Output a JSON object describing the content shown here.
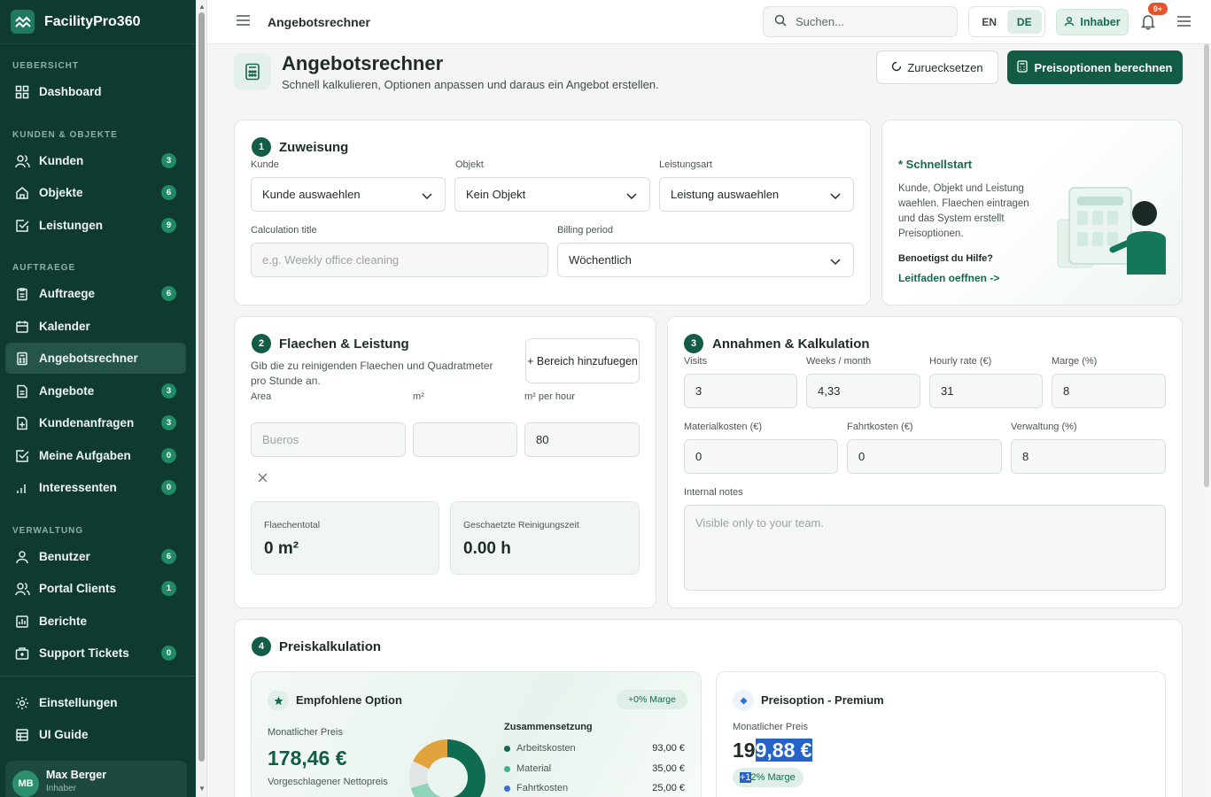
{
  "brand": {
    "name": "FacilityPro360"
  },
  "sidebar": {
    "sections": [
      "UEBERSICHT",
      "KUNDEN & OBJEKTE",
      "AUFTRAEGE",
      "VERWALTUNG"
    ],
    "items": [
      {
        "label": "Dashboard",
        "icon": "grid-icon"
      },
      {
        "label": "Kunden",
        "badge": "3",
        "icon": "users-icon"
      },
      {
        "label": "Objekte",
        "badge": "6",
        "icon": "home-icon"
      },
      {
        "label": "Leistungen",
        "badge": "9",
        "icon": "check-square-icon"
      },
      {
        "label": "Auftraege",
        "badge": "6",
        "icon": "clipboard-icon"
      },
      {
        "label": "Kalender",
        "icon": "calendar-icon"
      },
      {
        "label": "Angebotsrechner",
        "icon": "calculator-icon",
        "active": true
      },
      {
        "label": "Angebote",
        "badge": "3",
        "icon": "file-icon"
      },
      {
        "label": "Kundenanfragen",
        "badge": "3",
        "icon": "file-plus-icon"
      },
      {
        "label": "Meine Aufgaben",
        "badge": "0",
        "icon": "check-square-icon"
      },
      {
        "label": "Interessenten",
        "badge": "0",
        "icon": "bar-chart-icon"
      },
      {
        "label": "Benutzer",
        "badge": "6",
        "icon": "user-icon"
      },
      {
        "label": "Portal Clients",
        "badge": "1",
        "icon": "users-icon"
      },
      {
        "label": "Berichte",
        "icon": "report-icon"
      },
      {
        "label": "Support Tickets",
        "badge": "0",
        "icon": "ticket-icon"
      },
      {
        "label": "Einstellungen",
        "icon": "gear-icon"
      },
      {
        "label": "UI Guide",
        "icon": "table-icon"
      }
    ],
    "user": {
      "initials": "MB",
      "name": "Max Berger",
      "role": "Inhaber"
    }
  },
  "topbar": {
    "title": "Angebotsrechner",
    "search_placeholder": "Suchen...",
    "lang_en": "EN",
    "lang_de": "DE",
    "role": "Inhaber",
    "notifications": "9+"
  },
  "header": {
    "title": "Angebotsrechner",
    "subtitle": "Schnell kalkulieren, Optionen anpassen und daraus ein Angebot erstellen.",
    "reset_label": "Zuruecksetzen",
    "calc_label": "Preisoptionen berechnen"
  },
  "assignment": {
    "step": "1",
    "title": "Zuweisung",
    "customer_label": "Kunde",
    "customer_value": "Kunde auswaehlen",
    "object_label": "Objekt",
    "object_value": "Kein Objekt",
    "service_label": "Leistungsart",
    "service_value": "Leistung auswaehlen",
    "calc_title_label": "Calculation title",
    "calc_title_placeholder": "e.g. Weekly office cleaning",
    "billing_label": "Billing period",
    "billing_value": "Wöchentlich"
  },
  "quickstart": {
    "title": "* Schnellstart",
    "text": "Kunde, Objekt und Leistung waehlen. Flaechen eintragen und das System erstellt Preisoptionen.",
    "help": "Benoetigst du Hilfe?",
    "link": "Leitfaden oeffnen ->"
  },
  "areas": {
    "step": "2",
    "title": "Flaechen & Leistung",
    "description": "Gib die zu reinigenden Flaechen und Quadratmeter pro Stunde an.",
    "add_label": "+ Bereich hinzufuegen",
    "col_area": "Area",
    "col_m2": "m²",
    "col_rate": "m² per hour",
    "row_area_placeholder": "Bueros",
    "row_m2": "",
    "row_rate": "80",
    "total_label": "Flaechentotal",
    "total_value": "0 m²",
    "time_label": "Geschaetzte Reinigungszeit",
    "time_value": "0.00 h"
  },
  "assumptions": {
    "step": "3",
    "title": "Annahmen & Kalkulation",
    "visits_label": "Visits",
    "visits": "3",
    "weeks_label": "Weeks / month",
    "weeks": "4,33",
    "rate_label": "Hourly rate (€)",
    "rate": "31",
    "margin_label": "Marge (%)",
    "margin": "8",
    "material_label": "Materialkosten (€)",
    "material": "0",
    "travel_label": "Fahrtkosten (€)",
    "travel": "0",
    "admin_label": "Verwaltung (%)",
    "admin": "8",
    "notes_label": "Internal notes",
    "notes_placeholder": "Visible only to your team."
  },
  "pricing": {
    "step": "4",
    "title": "Preiskalkulation",
    "recommended": {
      "title": "Empfohlene Option",
      "margin_pill": "+0% Marge",
      "monthly_label": "Monatlicher Preis",
      "price": "178,46 €",
      "note": "Vorgeschlagener Nettopreis",
      "composition_title": "Zusammensetzung",
      "composition": [
        {
          "label": "Arbeitskosten",
          "value": "93,00 €",
          "color": "#0f6b52"
        },
        {
          "label": "Material",
          "value": "35,00 €",
          "color": "#3bb58a"
        },
        {
          "label": "Fahrtkosten",
          "value": "25,00 €",
          "color": "#2f6fd6"
        }
      ]
    },
    "premium": {
      "title": "Preisoption - Premium",
      "monthly_label": "Monatlicher Preis",
      "price_a": "19",
      "price_b": "9,88 €",
      "pill_a": "+1",
      "pill_b": "2% Marge"
    }
  },
  "colors": {
    "sidebar": "#0f3a31",
    "accent": "#125c46",
    "highlight": "#2563c9"
  }
}
